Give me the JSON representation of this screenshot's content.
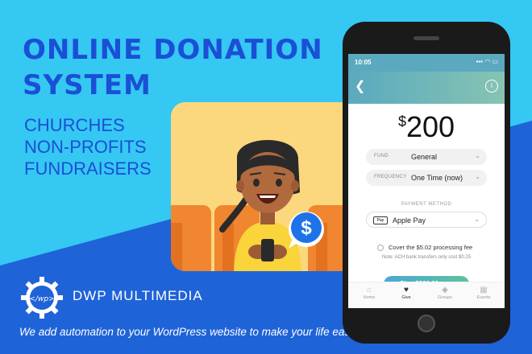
{
  "headline": {
    "line1": "ONLINE DONATION",
    "line2": "SYSTEM"
  },
  "audiences": [
    "CHURCHES",
    "NON-PROFITS",
    "FUNDRAISERS"
  ],
  "brand": {
    "name": "DWP MULTIMEDIA",
    "logo_text": "</wp>"
  },
  "tagline": "We add automation to your WordPress website to make your life easier.",
  "colors": {
    "sky": "#34c8f3",
    "royal_blue": "#1b4fd6",
    "illustration_bg": "#fbd87d",
    "dollar_bubble": "#1e73e8"
  },
  "phone": {
    "status_time": "10:05",
    "status_icons": "▪▪▪ ◠ ▭",
    "amount_symbol": "$",
    "amount_value": "200",
    "fields": [
      {
        "label": "FUND",
        "value": "General"
      },
      {
        "label": "FREQUENCY",
        "value": "One Time (now)"
      }
    ],
    "payment_method_label": "PAYMENT METHOD",
    "payment_badge": "Pay",
    "payment_value": "Apple Pay",
    "cover_fee_label": "Cover the $5.02 processing fee",
    "ach_note": "Note: ACH bank transfers only cost $0.25",
    "give_button": "Give $200.00 now",
    "tabs": [
      {
        "label": "Home",
        "icon": "home-icon"
      },
      {
        "label": "Give",
        "icon": "give-icon"
      },
      {
        "label": "Groups",
        "icon": "groups-icon"
      },
      {
        "label": "Events",
        "icon": "events-icon"
      }
    ]
  },
  "illustration": {
    "dollar": "$"
  }
}
